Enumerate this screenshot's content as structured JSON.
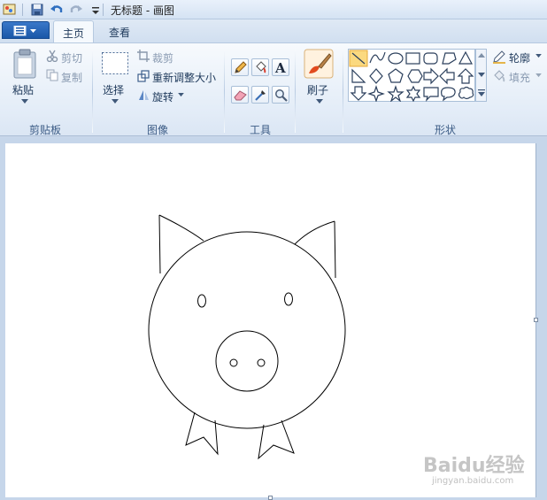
{
  "window": {
    "title": "无标题 - 画图"
  },
  "tabs": [
    {
      "label": "主页"
    },
    {
      "label": "查看"
    }
  ],
  "clipboard": {
    "paste_label": "粘贴",
    "cut_label": "剪切",
    "copy_label": "复制",
    "group_label": "剪贴板"
  },
  "image": {
    "select_label": "选择",
    "crop_label": "裁剪",
    "resize_label": "重新调整大小",
    "rotate_label": "旋转",
    "group_label": "图像"
  },
  "tools": {
    "group_label": "工具"
  },
  "brushes": {
    "label": "刷子"
  },
  "shapes": {
    "group_label": "形状",
    "outline_label": "轮廓",
    "fill_label": "填充"
  },
  "watermark": {
    "text": "Baidu经验",
    "sub": "jingyan.baidu.com"
  },
  "colors": {
    "accent": "#1a57a8",
    "selected_shape": "#fbd97f"
  }
}
